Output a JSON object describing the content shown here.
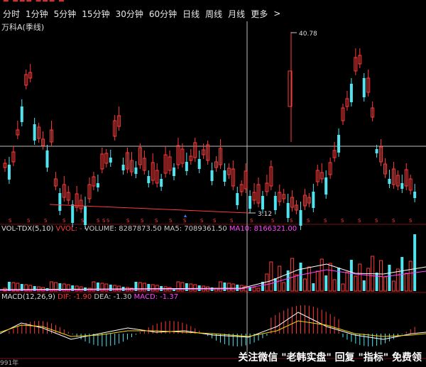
{
  "tabs": [
    {
      "label": "分时"
    },
    {
      "label": "1分钟"
    },
    {
      "label": "5分钟"
    },
    {
      "label": "15分钟"
    },
    {
      "label": "30分钟"
    },
    {
      "label": "60分钟"
    },
    {
      "label": "日线"
    },
    {
      "label": "周线"
    },
    {
      "label": "月线"
    },
    {
      "label": "更多"
    }
  ],
  "more_chevron": ">",
  "stock": {
    "label": "万科A(季线)"
  },
  "annotations": {
    "high": "40.78",
    "low": "3.12"
  },
  "vol_legend": {
    "name": "VOL-TDX(5,10)",
    "vvol": "VVOL: -",
    "volume": "VOLUME: 8287873.50",
    "ma5": "MA5: 7089361.50",
    "ma10": "MA10: 8166321.00"
  },
  "macd_legend": {
    "name": "MACD(12,26,9)",
    "dif": "DIF: -1.90",
    "dea": "DEA: -1.30",
    "macd": "MACD: -1.37"
  },
  "watermark": "关注微信 \"老韩实盘\" 回复 \"指标\" 免费领",
  "date_strip": "991年",
  "colors": {
    "up": "#ff3a3a",
    "down": "#4fe4f0",
    "bg": "#000000",
    "grid": "#7a1010",
    "ma5": "#ffffff",
    "ma10": "#ff44ff",
    "dif": "#ffffff",
    "dea": "#ffd400"
  },
  "signal_marker": "S"
}
